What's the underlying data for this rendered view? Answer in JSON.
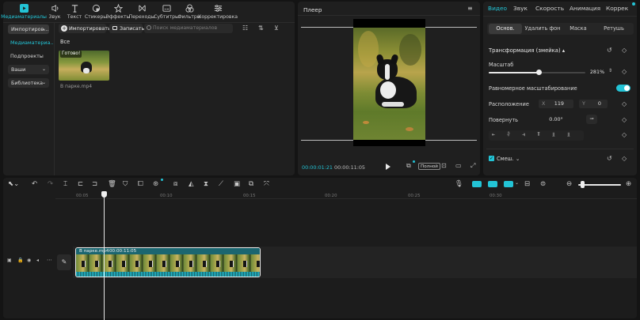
{
  "toolbar": {
    "items": [
      {
        "label": "Медиаматериалы",
        "icon": "media-icon",
        "active": true
      },
      {
        "label": "Звук",
        "icon": "audio-icon"
      },
      {
        "label": "Текст",
        "icon": "text-icon"
      },
      {
        "label": "Стикеры",
        "icon": "sticker-icon"
      },
      {
        "label": "Эффекты",
        "icon": "effects-icon"
      },
      {
        "label": "Переходы",
        "icon": "transitions-icon"
      },
      {
        "label": "Субтитры",
        "icon": "subtitles-icon"
      },
      {
        "label": "Фильтры",
        "icon": "filters-icon"
      },
      {
        "label": "Корректировка",
        "icon": "adjust-icon"
      }
    ]
  },
  "sidebar": {
    "import_dropdown": "Импортиров...",
    "media_link": "Медиаматериа...",
    "projects": "Подпроекты",
    "yours": "Ваши",
    "library": "Библиотека"
  },
  "media": {
    "import_button": "Импортировать",
    "record_button": "Записать",
    "search_placeholder": "Поиск медиаматериалов",
    "all_label": "Все",
    "clip_badge": "Готово!",
    "clip_name": "В парке.mp4"
  },
  "player": {
    "title": "Плеер",
    "current_time": "00:00:01:21",
    "total_time": "00:00:11:05",
    "full_button": "Полной"
  },
  "props": {
    "tabs": [
      "Видео",
      "Звук",
      "Скорость",
      "Анимация",
      "Коррек"
    ],
    "subtabs": [
      "Основ.",
      "Удалить фон",
      "Маска",
      "Ретушь"
    ],
    "transform_title": "Трансформация (змейка)",
    "scale_label": "Масштаб",
    "scale_value": "281%",
    "scale_fraction": 0.52,
    "uniform_label": "Равномерное масштабирование",
    "position_label": "Расположение",
    "pos_x_label": "X",
    "pos_x": "119",
    "pos_y_label": "Y",
    "pos_y": "0",
    "rotate_label": "Повернуть",
    "rotate_value": "0.00°",
    "blend_label": "Смеш."
  },
  "timeline": {
    "ruler": [
      "00:00",
      "00:05",
      "00:10",
      "00:15",
      "00:20",
      "00:25",
      "00:30"
    ],
    "clip_name": "В парке.mp4",
    "clip_duration": "00:00:11:05"
  },
  "colors": {
    "accent": "#23c4d6",
    "panel": "#1f1f1f",
    "background": "#141414"
  }
}
